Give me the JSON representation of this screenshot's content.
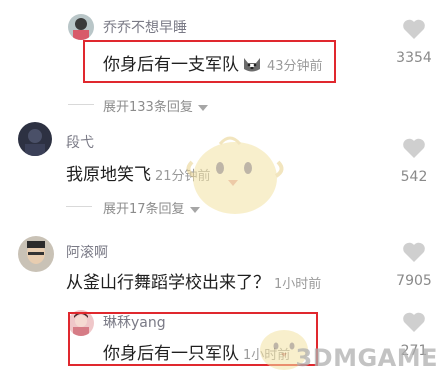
{
  "comments": [
    {
      "username": "乔乔不想早睡",
      "text": "你身后有一支军队",
      "time": "43分钟前",
      "likes": "3354",
      "expand_label": "展开133条回复",
      "highlighted": true
    },
    {
      "username": "段弋",
      "text": "我原地笑飞",
      "time": "21分钟前",
      "likes": "542",
      "expand_label": "展开17条回复",
      "highlighted": false
    },
    {
      "username": "阿滚啊",
      "text": "从釜山行舞蹈学校出来了？",
      "time": "1小时前",
      "likes": "7905",
      "highlighted": false
    },
    {
      "username": "琳秝yang",
      "text": "你身后有一只军队",
      "time": "1小时前",
      "likes": "271",
      "highlighted": true
    }
  ],
  "watermark": {
    "text_prefix": "3D",
    "text_main": "MGAME",
    "text_prefix_full": "3DMGAME"
  },
  "colors": {
    "highlight_border": "#e0282e",
    "username": "#7a7a86",
    "text": "#1f1f1f",
    "muted": "#9a9a9a",
    "like_icon": "#cfcfcf"
  },
  "icons": {
    "like": "heart-icon",
    "expand": "caret-down-icon",
    "emoji": "husky-dog-emoji-icon",
    "back": "chevron-left-icon"
  }
}
